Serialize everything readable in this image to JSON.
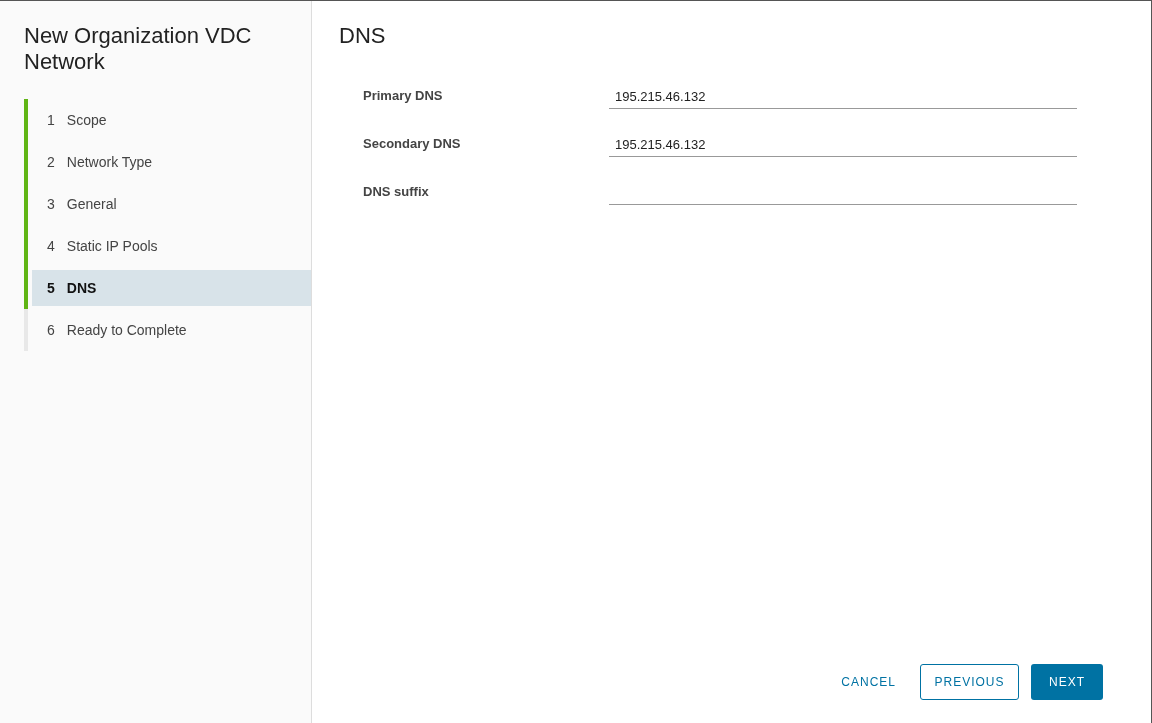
{
  "wizard": {
    "title": "New Organization VDC Network"
  },
  "steps": [
    {
      "number": "1",
      "label": "Scope",
      "completed": true,
      "selected": false
    },
    {
      "number": "2",
      "label": "Network Type",
      "completed": true,
      "selected": false
    },
    {
      "number": "3",
      "label": "General",
      "completed": true,
      "selected": false
    },
    {
      "number": "4",
      "label": "Static IP Pools",
      "completed": true,
      "selected": false
    },
    {
      "number": "5",
      "label": "DNS",
      "completed": true,
      "selected": true
    },
    {
      "number": "6",
      "label": "Ready to Complete",
      "completed": false,
      "selected": false
    }
  ],
  "page": {
    "title": "DNS"
  },
  "fields": [
    {
      "label": "Primary DNS",
      "value": "195.215.46.132"
    },
    {
      "label": "Secondary DNS",
      "value": "195.215.46.132"
    },
    {
      "label": "DNS suffix"
    }
  ],
  "buttons": {
    "cancel": "CANCEL",
    "previous": "PREVIOUS",
    "next": "NEXT"
  }
}
